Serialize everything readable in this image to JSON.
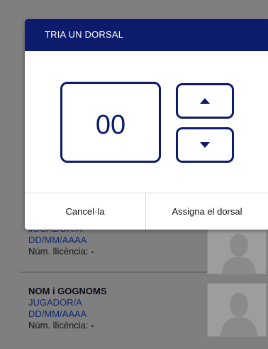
{
  "dialog": {
    "title": "TRIA UN DORSAL",
    "value": "00",
    "up_icon": "caret-up-icon",
    "down_icon": "caret-down-icon",
    "cancel_label": "Cancel·la",
    "assign_label": "Assigna el dorsal"
  },
  "players": [
    {
      "name": "",
      "role": "JUGADOR/A",
      "date": "DD/MM/AAAA",
      "license_label": "Núm. llicència:",
      "license_value": "-"
    },
    {
      "name": "NOM i GOGNOMS",
      "role": "JUGADOR/A",
      "date": "DD/MM/AAAA",
      "license_label": "Núm. llicència:",
      "license_value": "-"
    }
  ],
  "colors": {
    "primary": "#0c1b6b",
    "overlay": "#7f7f7f"
  }
}
